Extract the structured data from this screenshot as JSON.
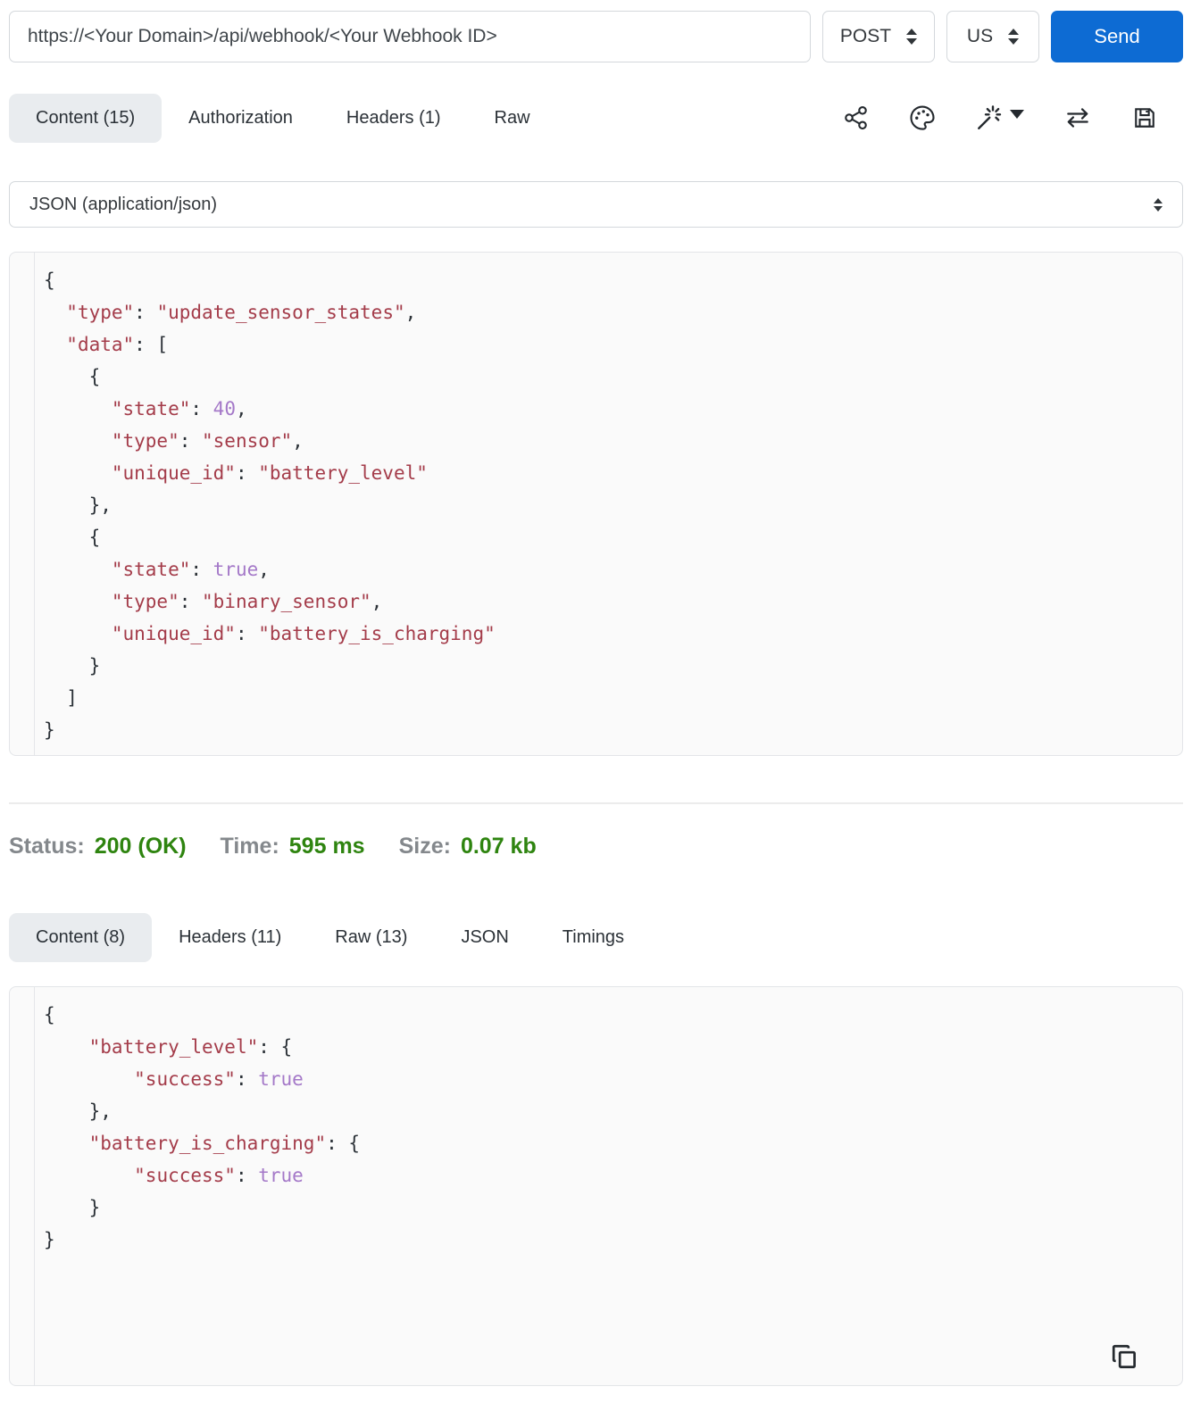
{
  "request_bar": {
    "url_value": "https://<Your Domain>/api/webhook/<Your Webhook ID>",
    "method": "POST",
    "environment": "US",
    "send_label": "Send"
  },
  "request_tabs": [
    {
      "label": "Content (15)",
      "active": true
    },
    {
      "label": "Authorization",
      "active": false
    },
    {
      "label": "Headers (1)",
      "active": false
    },
    {
      "label": "Raw",
      "active": false
    }
  ],
  "toolbar": {
    "icons": [
      "share-icon",
      "palette-icon",
      "magic-wand-icon",
      "swap-icon",
      "save-icon"
    ]
  },
  "body_type_select": {
    "value": "JSON (application/json)"
  },
  "request_body": {
    "lines": [
      [
        [
          "{"
        ]
      ],
      [
        [
          "  "
        ],
        [
          "\"type\"",
          "k"
        ],
        [
          ": "
        ],
        [
          "\"update_sensor_states\"",
          "s"
        ],
        [
          ","
        ]
      ],
      [
        [
          "  "
        ],
        [
          "\"data\"",
          "k"
        ],
        [
          ": ["
        ]
      ],
      [
        [
          "    {"
        ]
      ],
      [
        [
          "      "
        ],
        [
          "\"state\"",
          "k"
        ],
        [
          ": "
        ],
        [
          "40",
          "n"
        ],
        [
          ","
        ]
      ],
      [
        [
          "      "
        ],
        [
          "\"type\"",
          "k"
        ],
        [
          ": "
        ],
        [
          "\"sensor\"",
          "s"
        ],
        [
          ","
        ]
      ],
      [
        [
          "      "
        ],
        [
          "\"unique_id\"",
          "k"
        ],
        [
          ": "
        ],
        [
          "\"battery_level\"",
          "s"
        ]
      ],
      [
        [
          "    },"
        ]
      ],
      [
        [
          "    {"
        ]
      ],
      [
        [
          "      "
        ],
        [
          "\"state\"",
          "k"
        ],
        [
          ": "
        ],
        [
          "true",
          "b"
        ],
        [
          ","
        ]
      ],
      [
        [
          "      "
        ],
        [
          "\"type\"",
          "k"
        ],
        [
          ": "
        ],
        [
          "\"binary_sensor\"",
          "s"
        ],
        [
          ","
        ]
      ],
      [
        [
          "      "
        ],
        [
          "\"unique_id\"",
          "k"
        ],
        [
          ": "
        ],
        [
          "\"battery_is_charging\"",
          "s"
        ]
      ],
      [
        [
          "    }"
        ]
      ],
      [
        [
          "  ]"
        ]
      ],
      [
        [
          "}"
        ]
      ]
    ]
  },
  "status_bar": {
    "status_label": "Status:",
    "status_value": "200 (OK)",
    "time_label": "Time:",
    "time_value": "595 ms",
    "size_label": "Size:",
    "size_value": "0.07 kb"
  },
  "response_tabs": [
    {
      "label": "Content (8)",
      "active": true
    },
    {
      "label": "Headers (11)",
      "active": false
    },
    {
      "label": "Raw (13)",
      "active": false
    },
    {
      "label": "JSON",
      "active": false
    },
    {
      "label": "Timings",
      "active": false
    }
  ],
  "response_body": {
    "lines": [
      [
        [
          "{"
        ]
      ],
      [
        [
          "    "
        ],
        [
          "\"battery_level\"",
          "k"
        ],
        [
          ": {"
        ]
      ],
      [
        [
          "        "
        ],
        [
          "\"success\"",
          "k"
        ],
        [
          ": "
        ],
        [
          "true",
          "b"
        ]
      ],
      [
        [
          "    },"
        ]
      ],
      [
        [
          "    "
        ],
        [
          "\"battery_is_charging\"",
          "k"
        ],
        [
          ": {"
        ]
      ],
      [
        [
          "        "
        ],
        [
          "\"success\"",
          "k"
        ],
        [
          ": "
        ],
        [
          "true",
          "b"
        ]
      ],
      [
        [
          "    }"
        ]
      ],
      [
        [
          "}"
        ]
      ]
    ]
  },
  "colors": {
    "accent_blue": "#0d6bd3",
    "status_green": "#2e840f",
    "json_string": "#a43c4a",
    "json_literal": "#a478c8"
  }
}
